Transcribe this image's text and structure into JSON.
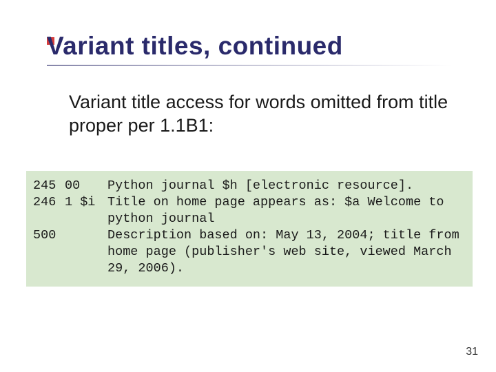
{
  "slide": {
    "title": "Variant titles, continued",
    "subtitle": "Variant title access for words omitted from title proper per 1.1B1:",
    "page_number": "31"
  },
  "marc": {
    "lines": [
      {
        "tag": "245",
        "indicators": "00",
        "text": "Python journal $h [electronic resource]."
      },
      {
        "tag": "246",
        "indicators": "1 $i",
        "text": "Title on home page appears as: $a Welcome to python journal"
      },
      {
        "tag": "500",
        "indicators": "",
        "text": "Description based on: May 13, 2004; title from home page (publisher's web site, viewed March 29, 2006)."
      }
    ]
  }
}
